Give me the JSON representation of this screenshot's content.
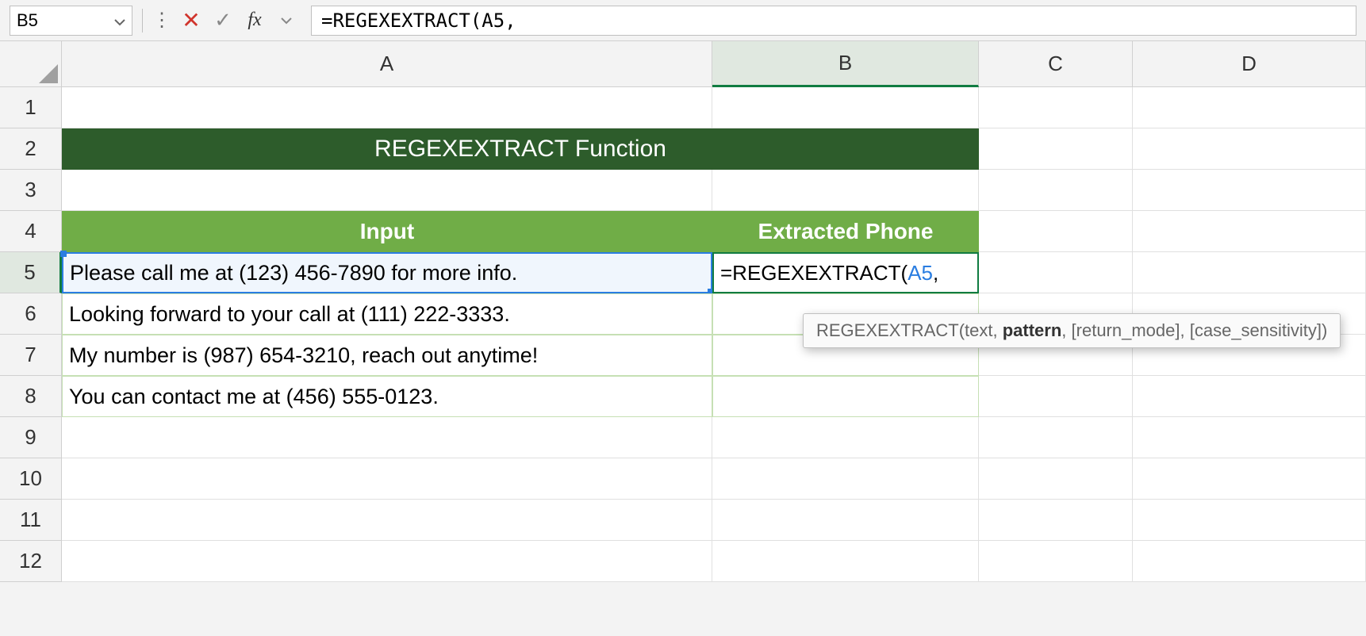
{
  "nameBox": "B5",
  "formulaBar": {
    "prefix": "=REGEXEXTRACT(",
    "ref": "A5",
    "suffix": ","
  },
  "columns": [
    "A",
    "B",
    "C",
    "D"
  ],
  "rows": [
    "1",
    "2",
    "3",
    "4",
    "5",
    "6",
    "7",
    "8",
    "9",
    "10",
    "11",
    "12"
  ],
  "activeRow": "5",
  "activeCol": "B",
  "title": "REGEXEXTRACT Function",
  "headers": {
    "input": "Input",
    "extracted": "Extracted Phone"
  },
  "inputData": [
    "Please call me at (123) 456-7890 for more info.",
    "Looking forward to your call at (111) 222-3333.",
    "My number is (987) 654-3210,  reach out anytime!",
    "You can contact me at (456) 555-0123."
  ],
  "cellFormula": {
    "prefix": "=REGEXEXTRACT(",
    "ref": "A5",
    "suffix": ","
  },
  "tooltip": {
    "fname": "REGEXEXTRACT",
    "p1": "text",
    "p2": "pattern",
    "p3": "[return_mode]",
    "p4": "[case_sensitivity]"
  }
}
